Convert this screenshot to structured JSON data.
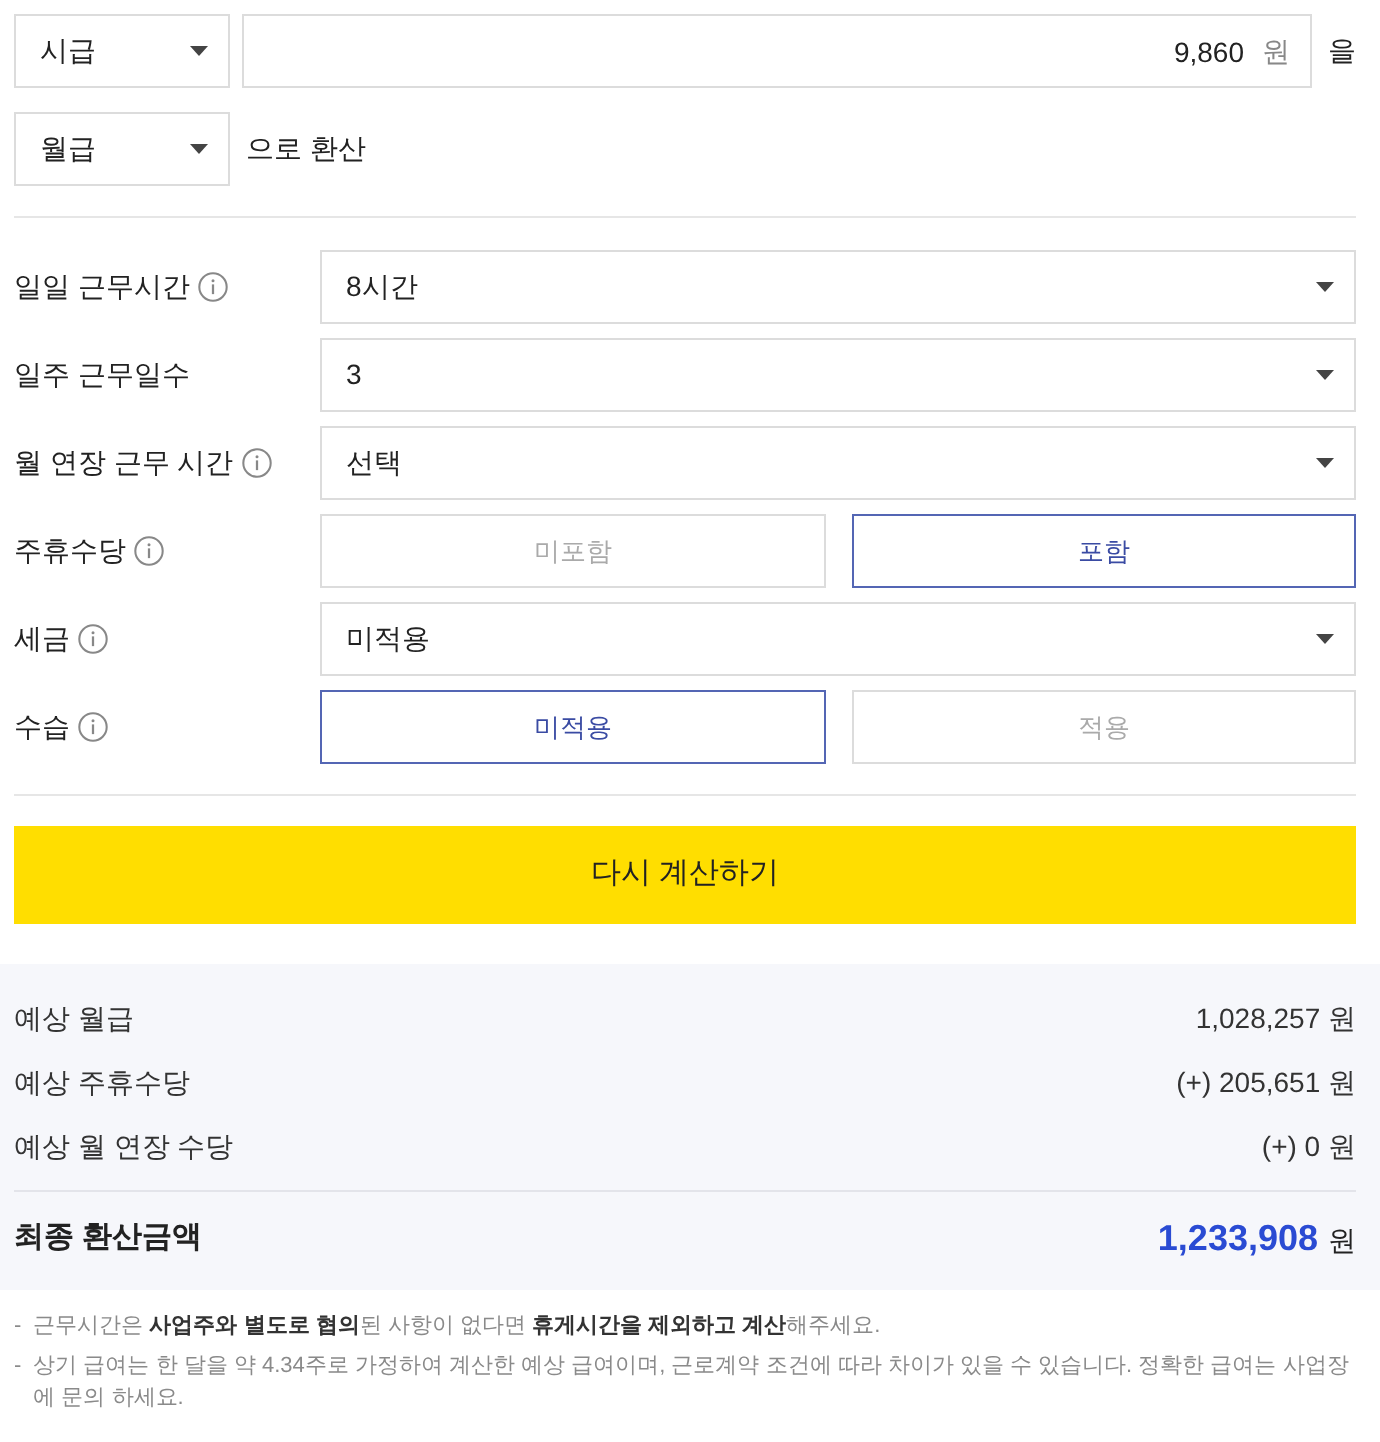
{
  "conversion": {
    "from_unit": "시급",
    "amount": "9,860",
    "amount_unit": "원",
    "particle": "을",
    "to_unit": "월급",
    "to_suffix": "으로 환산"
  },
  "fields": [
    {
      "kind": "select",
      "label": "일일 근무시간",
      "info": true,
      "value": "8시간"
    },
    {
      "kind": "select",
      "label": "일주 근무일수",
      "info": false,
      "value": "3"
    },
    {
      "kind": "select",
      "label": "월 연장 근무 시간",
      "info": true,
      "value": "선택"
    },
    {
      "kind": "toggle",
      "label": "주휴수당",
      "info": true,
      "options": [
        {
          "label": "미포함",
          "selected": false
        },
        {
          "label": "포함",
          "selected": true
        }
      ]
    },
    {
      "kind": "select",
      "label": "세금",
      "info": true,
      "value": "미적용"
    },
    {
      "kind": "toggle",
      "label": "수습",
      "info": true,
      "options": [
        {
          "label": "미적용",
          "selected": true
        },
        {
          "label": "적용",
          "selected": false
        }
      ]
    }
  ],
  "recalculate_button": "다시 계산하기",
  "results": [
    {
      "label": "예상 월급",
      "value": "1,028,257",
      "unit": "원"
    },
    {
      "label": "예상 주휴수당",
      "value": "(+) 205,651",
      "unit": "원"
    },
    {
      "label": "예상 월 연장 수당",
      "value": "(+) 0",
      "unit": "원"
    }
  ],
  "total": {
    "label": "최종 환산금액",
    "value": "1,233,908",
    "unit": "원"
  },
  "notes": [
    {
      "marker": "-",
      "text": "근무시간은 **사업주와 별도로 협의**된 사항이 없다면 **휴게시간을 제외하고 계산**해주세요."
    },
    {
      "marker": "-",
      "text": "상기 급여는 한 달을 약 4.34주로 가정하여 계산한 예상 급여이며, 근로계약 조건에 따라 차이가 있을 수 있습니다. 정확한 급여는 사업장에 문의 하세요."
    }
  ]
}
